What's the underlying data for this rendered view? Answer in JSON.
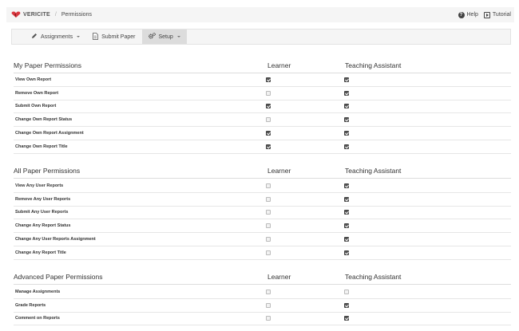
{
  "header": {
    "brand": "VERICITE",
    "separator": "/",
    "breadcrumb": "Permissions",
    "help_label": "Help",
    "tutorial_label": "Tutorial"
  },
  "nav": {
    "items": [
      {
        "label": "Assignments",
        "icon": "pencil-icon",
        "dropdown": true,
        "active": false
      },
      {
        "label": "Submit Paper",
        "icon": "document-icon",
        "dropdown": false,
        "active": false
      },
      {
        "label": "Setup",
        "icon": "gears-icon",
        "dropdown": true,
        "active": true
      }
    ]
  },
  "columns": {
    "learner": "Learner",
    "teaching_assistant": "Teaching Assistant"
  },
  "sections": [
    {
      "title": "My Paper Permissions",
      "rows": [
        {
          "label": "View Own Report",
          "learner": true,
          "ta": true
        },
        {
          "label": "Remove Own Report",
          "learner": false,
          "ta": true
        },
        {
          "label": "Submit Own Report",
          "learner": true,
          "ta": true
        },
        {
          "label": "Change Own Report Status",
          "learner": false,
          "ta": true
        },
        {
          "label": "Change Own Report Assignment",
          "learner": true,
          "ta": true
        },
        {
          "label": "Change Own Report Title",
          "learner": true,
          "ta": true
        }
      ]
    },
    {
      "title": "All Paper Permissions",
      "rows": [
        {
          "label": "View Any User Reports",
          "learner": false,
          "ta": true
        },
        {
          "label": "Remove Any User Reports",
          "learner": false,
          "ta": true
        },
        {
          "label": "Submit Any User Reports",
          "learner": false,
          "ta": true
        },
        {
          "label": "Change Any Report Status",
          "learner": false,
          "ta": true
        },
        {
          "label": "Change Any User Reports Assignment",
          "learner": false,
          "ta": true
        },
        {
          "label": "Change Any Report Title",
          "learner": false,
          "ta": true
        }
      ]
    },
    {
      "title": "Advanced Paper Permissions",
      "rows": [
        {
          "label": "Manage Assignments",
          "learner": false,
          "ta": false
        },
        {
          "label": "Grade Reports",
          "learner": false,
          "ta": true
        },
        {
          "label": "Comment on Reports",
          "learner": false,
          "ta": true
        }
      ]
    }
  ],
  "colors": {
    "logo_red": "#d9363e",
    "checked": "#555555",
    "topbar_bg": "#f5f5f5",
    "nav_active_bg": "#dcdcdc"
  }
}
